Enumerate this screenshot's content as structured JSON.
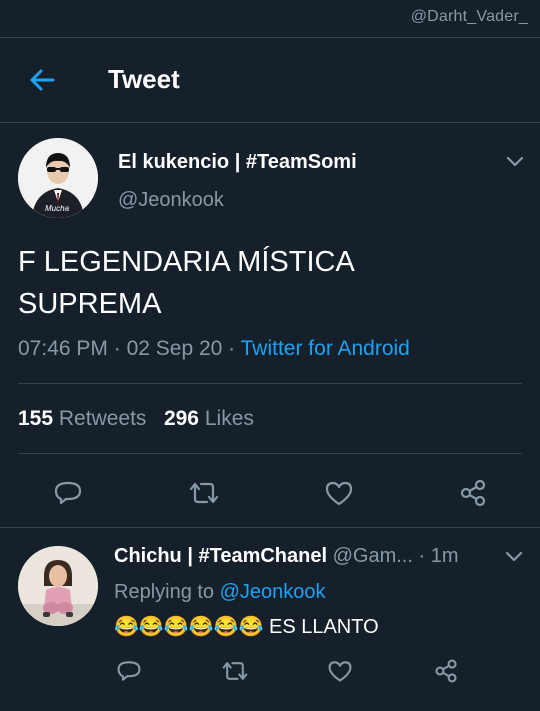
{
  "watermark": "@Darht_Vader_",
  "header": {
    "title": "Tweet"
  },
  "tweet": {
    "author_name": "El kukencio | #TeamSomi",
    "author_handle": "@Jeonkook",
    "avatar_caption": "Mucha",
    "text_line1": "F LEGENDARIA MÍSTICA",
    "text_line2": "SUPREMA",
    "time": "07:46 PM",
    "date": "02 Sep 20",
    "separator": " · ",
    "source": "Twitter for Android",
    "retweets_count": "155",
    "retweets_label": "Retweets",
    "likes_count": "296",
    "likes_label": "Likes"
  },
  "reply": {
    "author_name": "Chichu | #TeamChanel",
    "author_handle": "@Gam...",
    "time": "1m",
    "replying_prefix": "Replying to ",
    "replying_to": "@Jeonkook",
    "emojis": "😂😂😂😂😂😂",
    "text": " ES LLANTO"
  },
  "colors": {
    "background": "#15202b",
    "accent": "#1da1f2",
    "secondary_text": "#8899a6",
    "divider": "#38444d"
  },
  "icons": [
    "back-arrow-icon",
    "chevron-down-icon",
    "reply-icon",
    "retweet-icon",
    "like-icon",
    "share-icon"
  ]
}
